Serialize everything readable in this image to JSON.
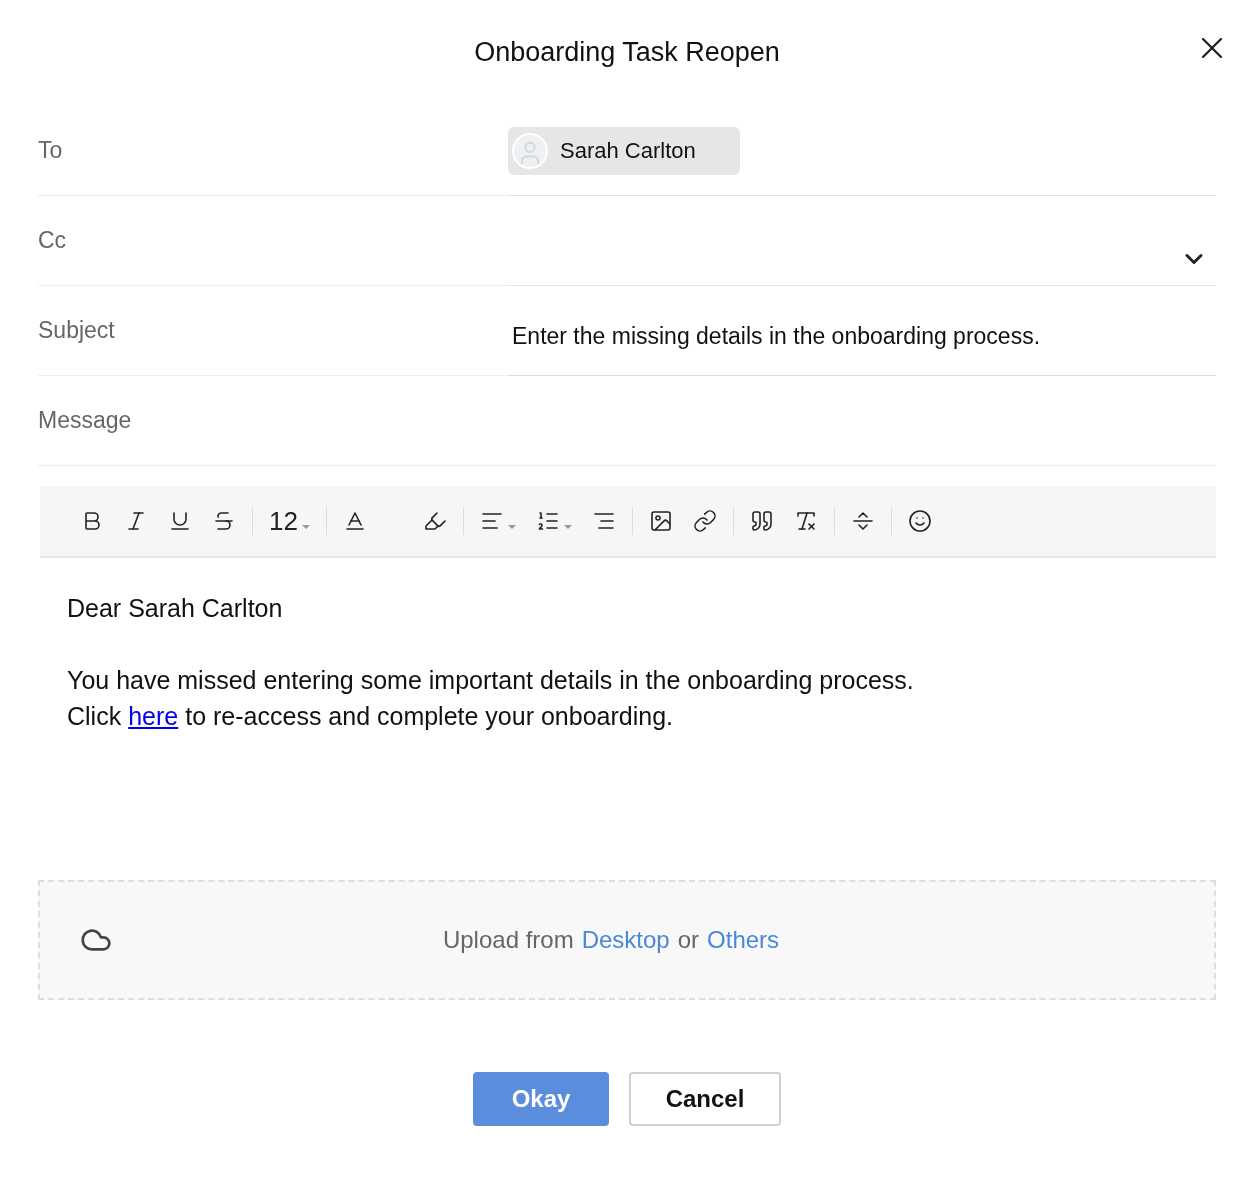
{
  "dialog": {
    "title": "Onboarding Task Reopen"
  },
  "fields": [
    {
      "kind": "recipient",
      "label": "To",
      "value": "Sarah Carlton"
    },
    {
      "kind": "dropdown",
      "label": "Cc"
    },
    {
      "kind": "text",
      "label": "Subject",
      "value": "Enter the missing details in the onboarding process."
    },
    {
      "kind": "heading",
      "label": "Message"
    }
  ],
  "toolbar": {
    "font_size": "12"
  },
  "message": {
    "greeting": "Dear Sarah Carlton",
    "line1": "You have missed entering some important details in the onboarding process.",
    "line2_before": "Click",
    "link": "here",
    "line2_after": "to re-access and complete your onboarding."
  },
  "upload": {
    "text": "Upload from",
    "desktop": "Desktop",
    "or": "or",
    "others": "Others"
  },
  "buttons": [
    {
      "kind": "primary",
      "label": "Okay"
    },
    {
      "kind": "secondary",
      "label": "Cancel"
    }
  ]
}
